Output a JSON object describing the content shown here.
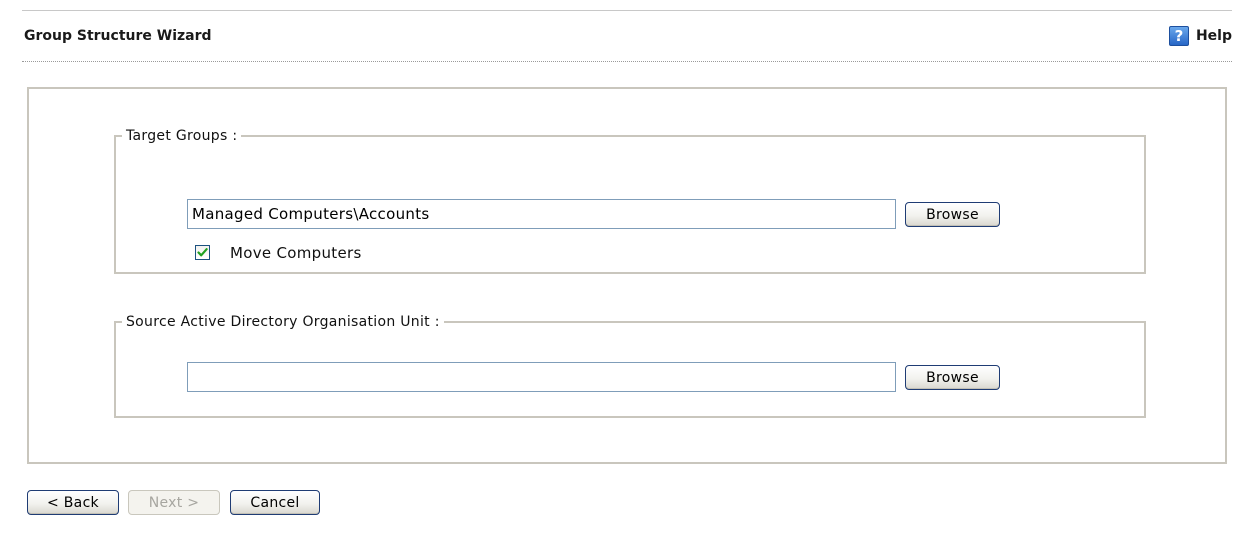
{
  "wizard": {
    "title": "Group Structure Wizard",
    "help_label": "Help",
    "help_icon": "help-icon"
  },
  "target_groups": {
    "legend": "Target Groups :",
    "value": "Managed Computers\\Accounts",
    "placeholder": "",
    "browse_label": "Browse",
    "move_computers_label": "Move Computers",
    "move_computers_checked": true
  },
  "source_ou": {
    "legend": "Source Active Directory Organisation Unit :",
    "value": "",
    "placeholder": "",
    "browse_label": "Browse"
  },
  "footer": {
    "back_label": "< Back",
    "next_label": "Next >",
    "cancel_label": "Cancel"
  },
  "colors": {
    "accent": "#2766c6",
    "checkmark": "#21a121",
    "panel_border": "#c9c6bd",
    "input_border": "#7f9db9"
  }
}
